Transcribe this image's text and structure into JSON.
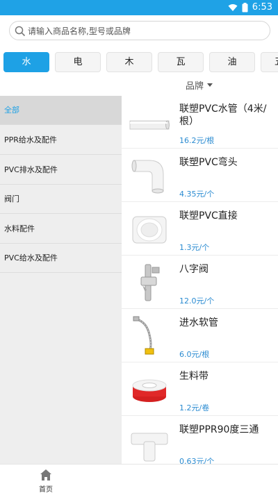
{
  "status": {
    "time": "6:53"
  },
  "search": {
    "placeholder": "请输入商品名称,型号或品牌"
  },
  "categories": [
    {
      "label": "水",
      "active": true
    },
    {
      "label": "电",
      "active": false
    },
    {
      "label": "木",
      "active": false
    },
    {
      "label": "瓦",
      "active": false
    },
    {
      "label": "油",
      "active": false
    },
    {
      "label": "五金",
      "active": false
    }
  ],
  "brand": {
    "label": "品牌"
  },
  "sidebar": {
    "items": [
      {
        "label": "全部",
        "active": true
      },
      {
        "label": "PPR给水及配件"
      },
      {
        "label": "PVC排水及配件"
      },
      {
        "label": "阀门"
      },
      {
        "label": "水料配件"
      },
      {
        "label": "PVC给水及配件"
      }
    ]
  },
  "products": [
    {
      "name": "联塑PVC水管（4米/根）",
      "price": "16.2",
      "unit": "元/根",
      "icon": "pipe"
    },
    {
      "name": "联塑PVC弯头",
      "price": "4.35",
      "unit": "元/个",
      "icon": "elbow"
    },
    {
      "name": "联塑PVC直接",
      "price": "1.3",
      "unit": "元/个",
      "icon": "coupling"
    },
    {
      "name": "八字阀",
      "price": "12.0",
      "unit": "元/个",
      "icon": "valve"
    },
    {
      "name": "进水软管",
      "price": "6.0",
      "unit": "元/根",
      "icon": "hose"
    },
    {
      "name": "生料带",
      "price": "1.2",
      "unit": "元/卷",
      "icon": "tape"
    },
    {
      "name": "联塑PPR90度三通",
      "price": "0.63",
      "unit": "元/个",
      "icon": "tee"
    }
  ],
  "bottomnav": {
    "home_label": "首页"
  }
}
